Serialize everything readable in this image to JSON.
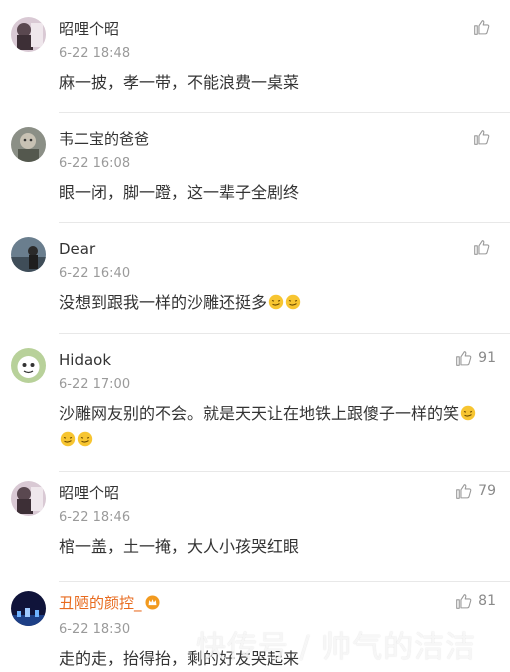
{
  "comments": [
    {
      "name": "昭哩个昭",
      "time": "6-22 18:48",
      "text": "麻一披，孝一带，不能浪费一桌菜",
      "likes": ""
    },
    {
      "name": "韦二宝的爸爸",
      "time": "6-22 16:08",
      "text": "眼一闭，脚一蹬，这一辈子全剧终",
      "likes": ""
    },
    {
      "name": "Dear⁪⁪⁪",
      "time": "6-22 16:40",
      "text": "没想到跟我一样的沙雕还挺多",
      "likes": ""
    },
    {
      "name": "Hidaok",
      "time": "6-22 17:00",
      "text": "沙雕网友别的不会。就是天天让在地铁上跟傻子一样的笑",
      "likes": "91"
    },
    {
      "name": "昭哩个昭",
      "time": "6-22 18:46",
      "text": "棺一盖，土一掩，大人小孩哭红眼",
      "likes": "79"
    },
    {
      "name": "丑陋的颜控_",
      "time": "6-22 18:30",
      "text": "走的走，抬得抬，剩的好友哭起来",
      "likes": "81"
    }
  ],
  "watermark": "快传号 / 帅气的洁洁",
  "icons": {
    "like": "thumbs-up-icon",
    "emoji": "smirk-face-emoji",
    "vip": "crown-badge-icon"
  },
  "colors": {
    "vip_name": "#e86b1f",
    "time": "#9a9a9a",
    "text": "#333333"
  }
}
